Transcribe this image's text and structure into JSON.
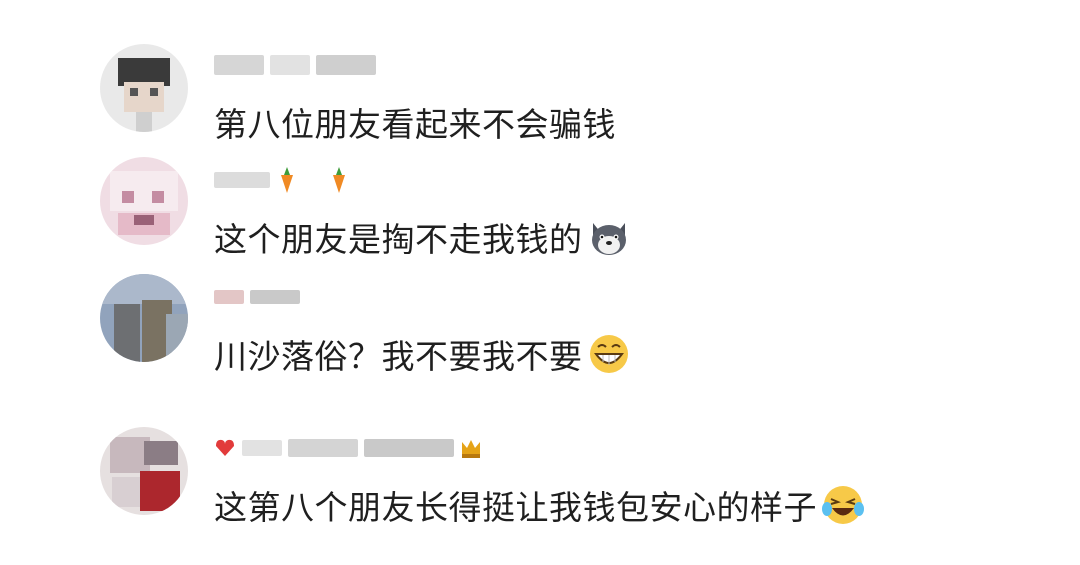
{
  "comments": [
    {
      "text": "第八位朋友看起来不会骗钱",
      "username_blurred": true,
      "avatar_icon": "pixelated-avatar"
    },
    {
      "text": "这个朋友是掏不走我钱的",
      "username_blurred": true,
      "name_badges": [
        "carrot-icon",
        "carrot-icon"
      ],
      "trailing_emoji": "husky-dog-emoji",
      "avatar_icon": "pixelated-avatar"
    },
    {
      "text": "川沙落俗？我不要我不要",
      "username_blurred": true,
      "trailing_emoji": "grinning-face-emoji",
      "avatar_icon": "pixelated-avatar"
    },
    {
      "text": "这第八个朋友长得挺让我钱包安心的样子",
      "username_blurred": true,
      "name_badges": [
        "red-heart-icon",
        "crown-icon"
      ],
      "trailing_emoji": "laughing-crying-emoji",
      "avatar_icon": "pixelated-avatar"
    }
  ]
}
